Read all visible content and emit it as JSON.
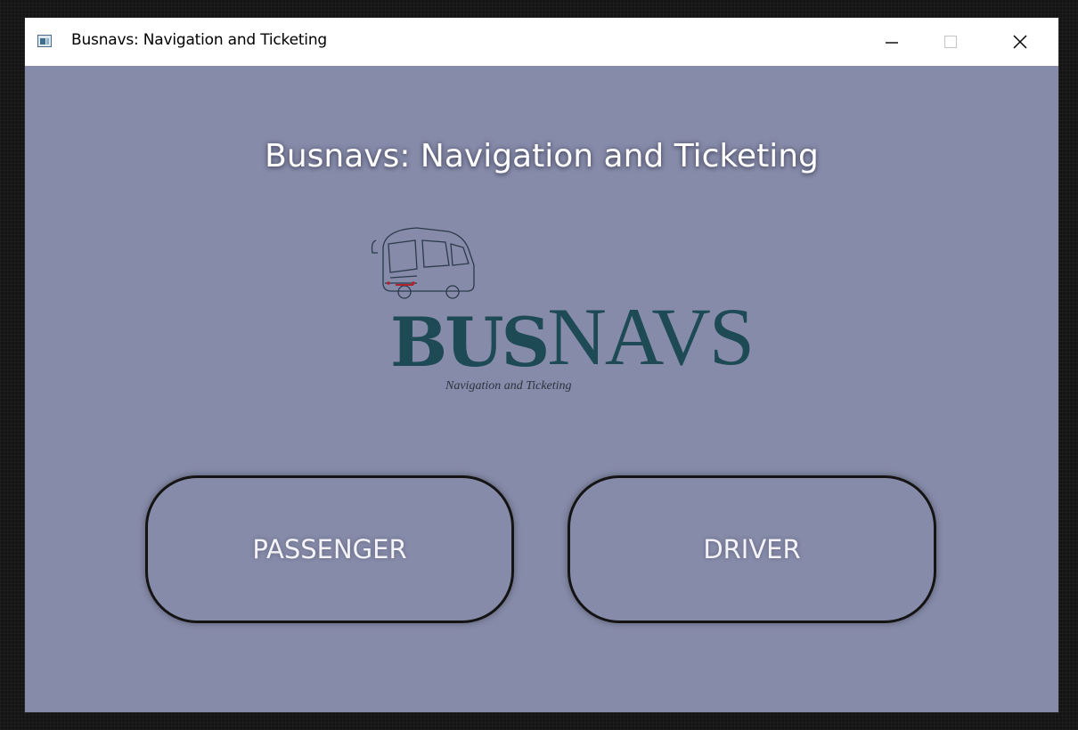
{
  "window": {
    "title": "Busnavs: Navigation and Ticketing",
    "app_icon": "app-window-icon",
    "controls": {
      "minimize": "minimize-icon",
      "maximize": "maximize-icon",
      "close": "close-icon"
    }
  },
  "main": {
    "heading": "Busnavs: Navigation and Ticketing",
    "logo": {
      "word_bold": "BUS",
      "word_light": "NAVS",
      "tagline": "Navigation and Ticketing",
      "color": "#1d4a54"
    },
    "buttons": {
      "passenger_label": "PASSENGER",
      "driver_label": "DRIVER"
    }
  },
  "colors": {
    "background": "#868ba9",
    "titlebar": "#ffffff",
    "button_border": "#141414",
    "text": "#ffffff"
  }
}
